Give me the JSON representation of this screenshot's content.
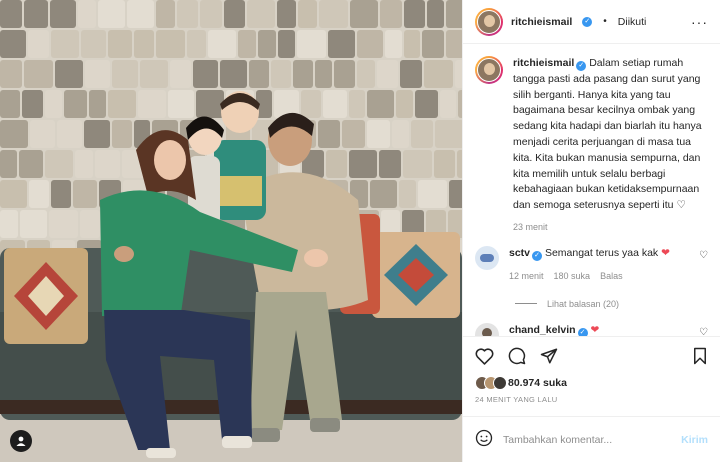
{
  "author": {
    "username": "ritchieismail",
    "follow_state": "Diikuti"
  },
  "caption": {
    "username": "ritchieismail",
    "text": "Dalam setiap rumah tangga pasti ada pasang dan surut yang silih berganti. Hanya kita yang tau bagaimana besar kecilnya ombak yang sedang kita hadapi dan biarlah itu hanya menjadi cerita perjuangan di masa tua kita. Kita bukan manusia sempurna, dan kita memilih untuk selalu berbagi kebahagiaan bukan ketidaksempurnaan dan semoga seterusnya seperti itu",
    "emoji": "♡",
    "time": "23 menit"
  },
  "comments": [
    {
      "username": "sctv",
      "text": "Semangat terus yaa kak",
      "emoji": "❤",
      "time": "12 menit",
      "likes": "180 suka",
      "reply_label": "Balas",
      "view_replies": "Lihat balasan (20)"
    },
    {
      "username": "chand_kelvin",
      "text": "",
      "emoji": "❤"
    }
  ],
  "likes": {
    "count_text": "80.974 suka"
  },
  "post_time": "24 MENIT YANG LALU",
  "add_comment": {
    "placeholder": "Tambahkan komentar...",
    "post_label": "Kirim"
  },
  "icons": {
    "header": [
      "verified-badge",
      "more-options-icon"
    ],
    "actions": [
      "heart-icon",
      "comment-icon",
      "share-icon",
      "bookmark-icon"
    ],
    "footer": [
      "emoji-icon"
    ],
    "photo": [
      "user-tag-icon"
    ]
  },
  "colors": {
    "verified": "#3897f0",
    "heart_red": "#ed4956",
    "post_button": "#b2dffc",
    "secondary_text": "#8e8e8e"
  }
}
